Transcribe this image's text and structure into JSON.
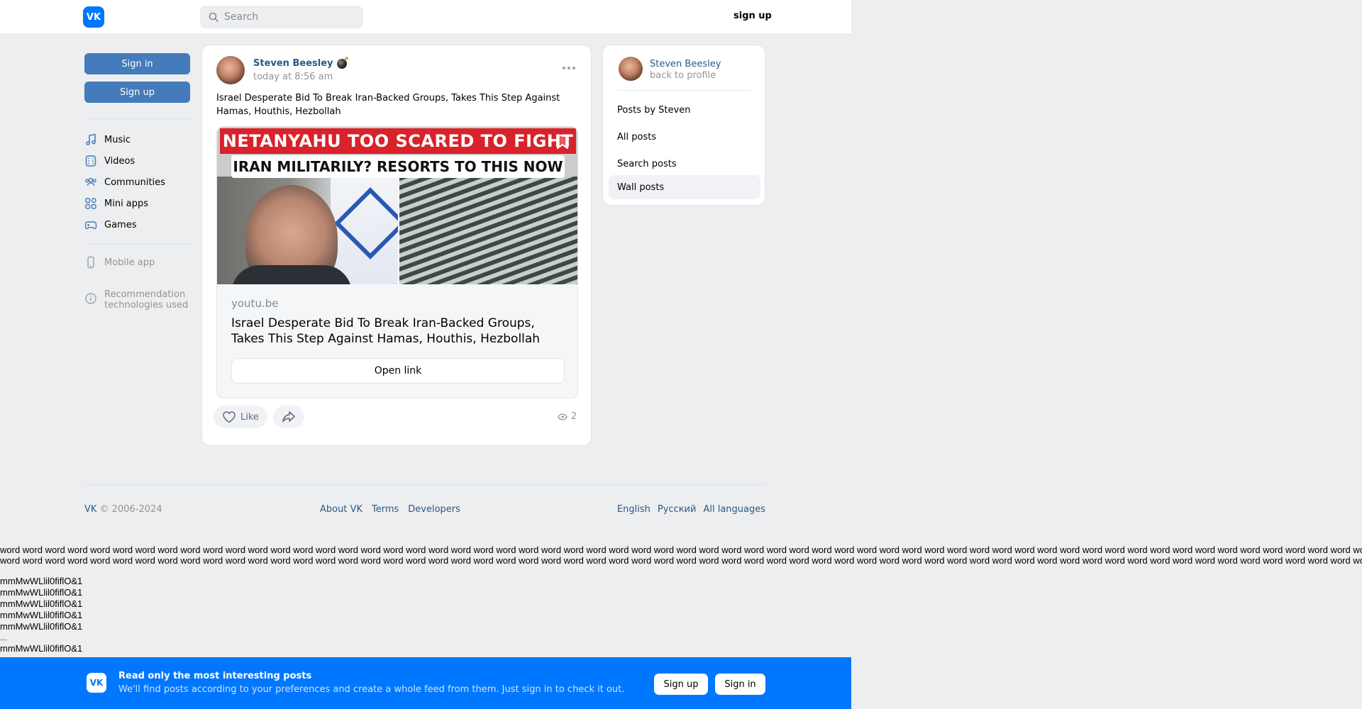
{
  "header": {
    "logo": "VK",
    "search_placeholder": "Search",
    "signup": "sign up"
  },
  "left_nav": {
    "sign_in": "Sign in",
    "sign_up": "Sign up",
    "items": [
      {
        "label": "Music",
        "icon": "music-icon"
      },
      {
        "label": "Videos",
        "icon": "video-icon"
      },
      {
        "label": "Communities",
        "icon": "communities-icon"
      },
      {
        "label": "Mini apps",
        "icon": "mini-apps-icon"
      },
      {
        "label": "Games",
        "icon": "gamepad-icon"
      }
    ],
    "mobile_app": "Mobile app",
    "recommendation": "Recommendation technologies used"
  },
  "post": {
    "author": "Steven Beesley",
    "time": "today at 8:56 am",
    "text": "Israel Desperate Bid To Break Iran-Backed Groups, Takes This Step Against Hamas, Houthis, Hezbollah",
    "thumb_line1": "NETANYAHU TOO SCARED TO FIGHT",
    "thumb_line2": "IRAN MILITARILY? RESORTS TO THIS NOW",
    "link_domain": "youtu.be",
    "link_title": "Israel Desperate Bid To Break Iran-Backed Groups, Takes This Step Against Hamas, Houthis, Hezbollah",
    "open_link": "Open link",
    "like": "Like",
    "views": "2"
  },
  "right_panel": {
    "name": "Steven Beesley",
    "back": "back to profile",
    "items": [
      "Posts by Steven",
      "All posts",
      "Search posts",
      "Wall posts"
    ]
  },
  "footer": {
    "vk": "VK",
    "copyright": " © 2006-2024",
    "links": [
      "About VK",
      "Terms",
      "Developers"
    ],
    "langs": [
      "English",
      "Русский",
      "All languages"
    ]
  },
  "test_text": {
    "words_line": "word word word word word word word word word word word word word word word word word word word word word word word word word word word word word word word word word word word word word word word word word word word word word word word word word word word word word word word word word word word word word word word word word word word word word word word word word word word",
    "mm": "mmMwWLlil0fiflO&1"
  },
  "bottom_banner": {
    "title": "Read only the most interesting posts",
    "subtitle": "We'll find posts according to your preferences and create a whole feed from them. Just sign in to check it out.",
    "sign_up": "Sign up",
    "sign_in": "Sign in"
  },
  "colors": {
    "brand": "#0077ff",
    "link": "#2a5885",
    "button": "#447bba"
  }
}
